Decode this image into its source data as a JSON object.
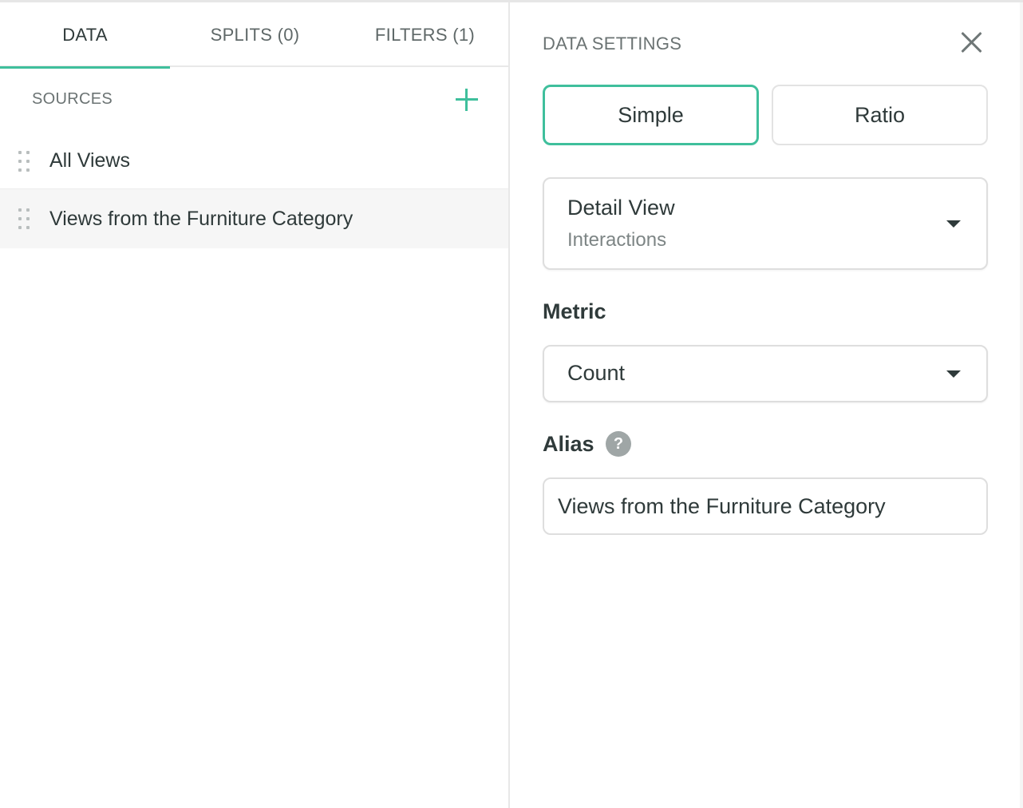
{
  "tabs": [
    {
      "label": "DATA",
      "active": true
    },
    {
      "label": "SPLITS (0)",
      "active": false
    },
    {
      "label": "FILTERS (1)",
      "active": false
    }
  ],
  "sources": {
    "header": "SOURCES",
    "add_icon": "plus-icon",
    "items": [
      {
        "label": "All Views",
        "selected": false
      },
      {
        "label": "Views from the Furniture Category",
        "selected": true
      }
    ]
  },
  "settings": {
    "title": "DATA SETTINGS",
    "close_icon": "close-icon",
    "mode_options": [
      "Simple",
      "Ratio"
    ],
    "selected_mode": "Simple",
    "event": {
      "primary": "Detail View",
      "secondary": "Interactions"
    },
    "metric": {
      "label": "Metric",
      "value": "Count"
    },
    "alias": {
      "label": "Alias",
      "help_icon": "question-icon",
      "help_glyph": "?",
      "value": "Views from the Furniture Category"
    }
  },
  "colors": {
    "accent": "#3fbf9c",
    "text": "#2f3a3a",
    "muted": "#6b7373",
    "border": "#dedede"
  }
}
